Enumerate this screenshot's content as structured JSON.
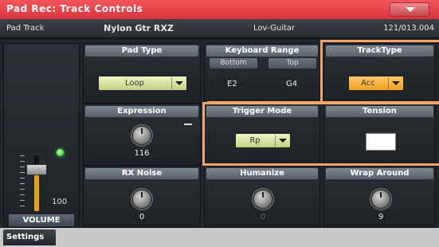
{
  "titlebar": {
    "title": "Pad Rec: Track Controls"
  },
  "infobar": {
    "track": "Pad Track",
    "sound": "Nylon Gtr RXZ",
    "sound_category": "Lov-Guitar",
    "position": "121/013.004"
  },
  "volume": {
    "label": "VOLUME",
    "value": "100",
    "level_fraction": 0.75
  },
  "pad_type": {
    "header": "Pad Type",
    "value": "Loop"
  },
  "keyboard_range": {
    "header": "Keyboard Range",
    "bottom_label": "Bottom",
    "top_label": "Top",
    "bottom_value": "E2",
    "top_value": "G4"
  },
  "track_type": {
    "header": "TrackType",
    "value": "Acc"
  },
  "expression": {
    "header": "Expression",
    "value": "116"
  },
  "trigger_mode": {
    "header": "Trigger Mode",
    "value": "Rp"
  },
  "tension": {
    "header": "Tension"
  },
  "rx_noise": {
    "header": "RX Noise",
    "value": "0"
  },
  "humanize": {
    "header": "Humanize",
    "value": "0"
  },
  "wrap_around": {
    "header": "Wrap Around",
    "value": "9"
  },
  "tabs": [
    {
      "label": "Settings"
    }
  ],
  "colors": {
    "title_bar": "#d8353c",
    "highlight": "#f4a46a",
    "led": "#2fbf2f",
    "slider_fill": "#e6a21e"
  }
}
